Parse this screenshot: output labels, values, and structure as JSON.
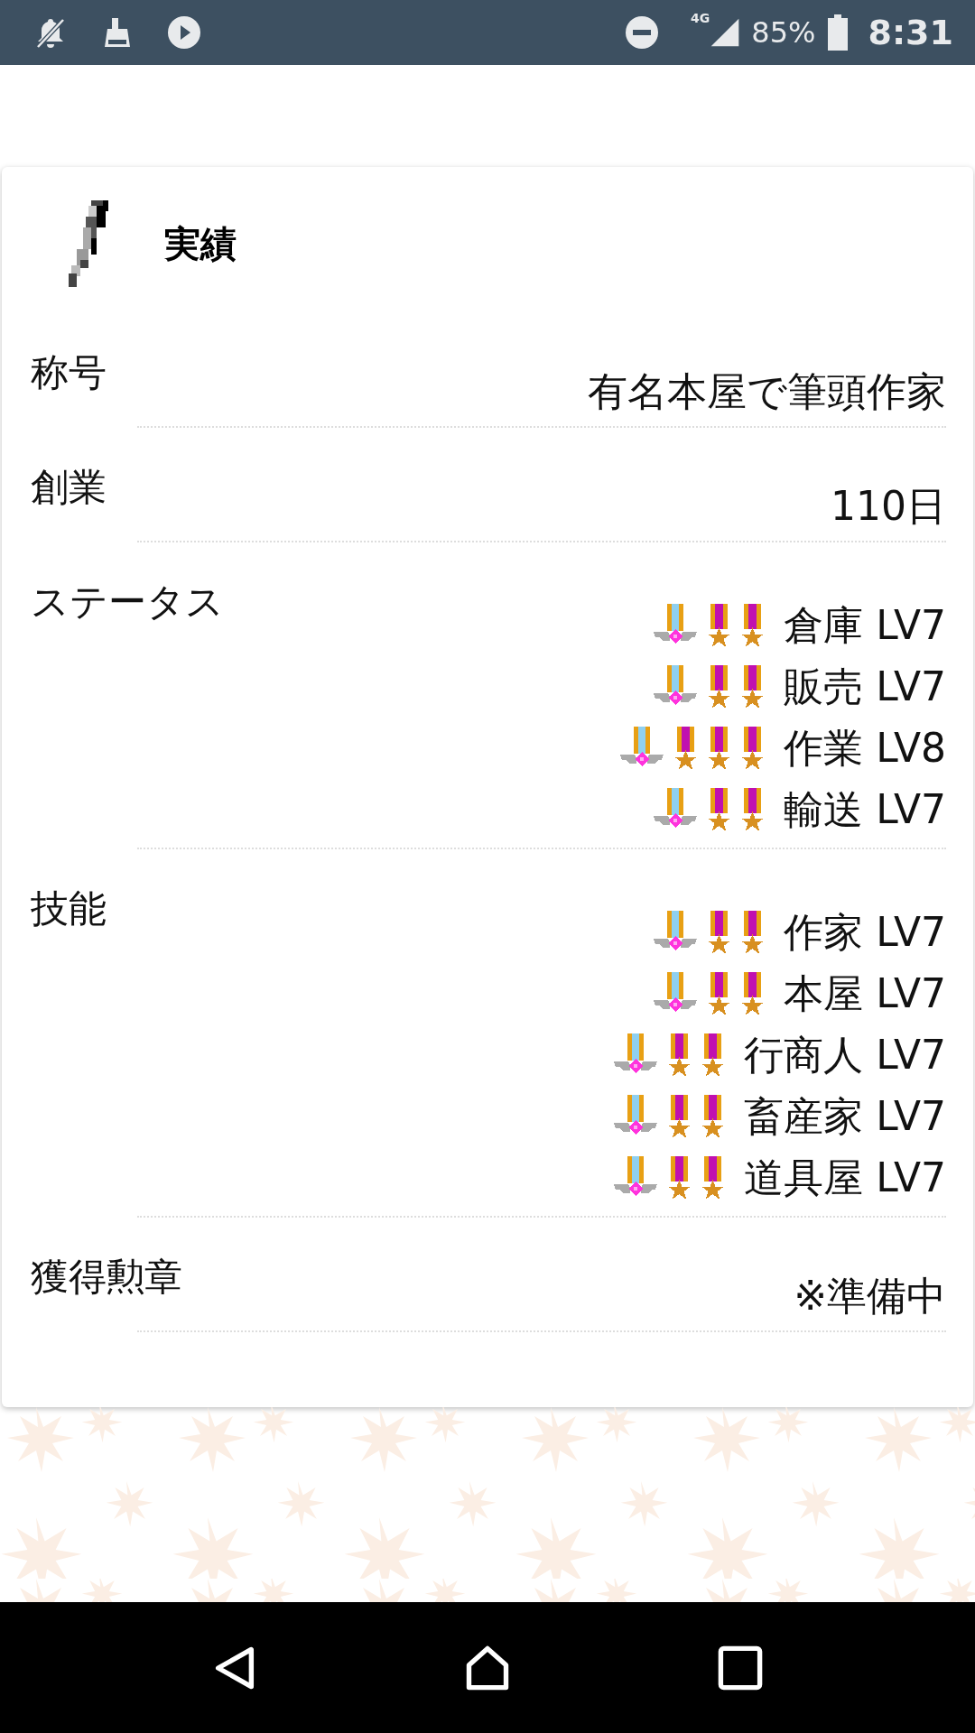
{
  "status_bar": {
    "network": "4G",
    "battery": "85%",
    "time": "8:31"
  },
  "card": {
    "title": "実績",
    "rows": [
      {
        "kind": "text",
        "label": "称号",
        "value": "有名本屋で筆頭作家"
      },
      {
        "kind": "text",
        "label": "創業",
        "value": "110日"
      },
      {
        "kind": "levels",
        "label": "ステータス",
        "items": [
          {
            "text": "倉庫 LV7",
            "medals": [
              {
                "kind": "winged"
              },
              {
                "kind": "star"
              },
              {
                "kind": "star"
              }
            ]
          },
          {
            "text": "販売 LV7",
            "medals": [
              {
                "kind": "winged"
              },
              {
                "kind": "star"
              },
              {
                "kind": "star"
              }
            ]
          },
          {
            "text": "作業 LV8",
            "medals": [
              {
                "kind": "winged"
              },
              {
                "kind": "star"
              },
              {
                "kind": "star"
              },
              {
                "kind": "star"
              }
            ]
          },
          {
            "text": "輸送 LV7",
            "medals": [
              {
                "kind": "winged"
              },
              {
                "kind": "star"
              },
              {
                "kind": "star"
              }
            ]
          }
        ]
      },
      {
        "kind": "levels",
        "label": "技能",
        "items": [
          {
            "text": "作家 LV7",
            "medals": [
              {
                "kind": "winged"
              },
              {
                "kind": "star"
              },
              {
                "kind": "star"
              }
            ]
          },
          {
            "text": "本屋 LV7",
            "medals": [
              {
                "kind": "winged"
              },
              {
                "kind": "star"
              },
              {
                "kind": "star"
              }
            ]
          },
          {
            "text": "行商人 LV7",
            "medals": [
              {
                "kind": "winged"
              },
              {
                "kind": "star"
              },
              {
                "kind": "star"
              }
            ]
          },
          {
            "text": "畜産家 LV7",
            "medals": [
              {
                "kind": "winged"
              },
              {
                "kind": "star"
              },
              {
                "kind": "star"
              }
            ]
          },
          {
            "text": "道具屋 LV7",
            "medals": [
              {
                "kind": "winged"
              },
              {
                "kind": "star"
              },
              {
                "kind": "star"
              }
            ]
          }
        ]
      },
      {
        "kind": "text",
        "label": "獲得勲章",
        "value": "※準備中"
      }
    ]
  }
}
